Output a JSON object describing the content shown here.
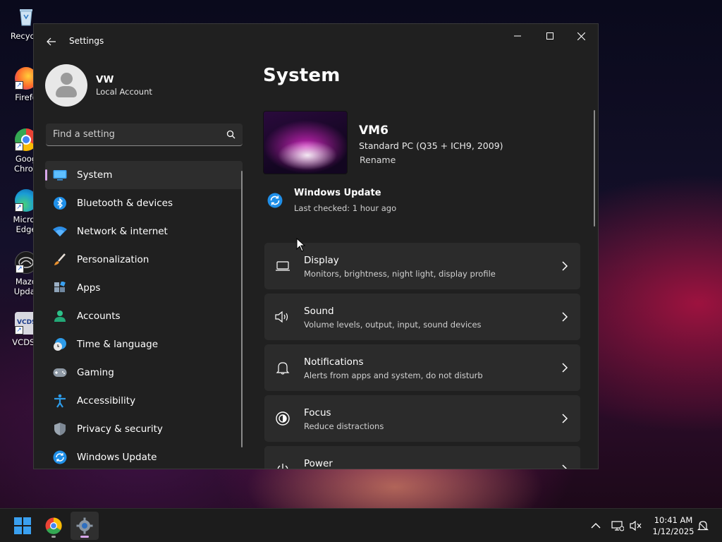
{
  "desktop": {
    "icons": [
      {
        "label": "Recycle",
        "icon": "recycle-bin-icon"
      },
      {
        "label": "Firefo",
        "icon": "firefox-icon"
      },
      {
        "label": "Goog\nChron",
        "icon": "chrome-icon"
      },
      {
        "label": "Micros\nEdge",
        "icon": "edge-icon"
      },
      {
        "label": "Mazd\nUpdat",
        "icon": "mazda-update-icon"
      },
      {
        "label": "VCDS-l",
        "icon": "vcds-icon"
      }
    ]
  },
  "window": {
    "title": "Settings",
    "controls": {
      "minimize": "—",
      "maximize": "☐",
      "close": "✕"
    }
  },
  "profile": {
    "name": "VW",
    "account_type": "Local Account"
  },
  "search": {
    "placeholder": "Find a setting",
    "value": ""
  },
  "sidebar": {
    "items": [
      {
        "label": "System",
        "icon": "system-icon",
        "selected": true
      },
      {
        "label": "Bluetooth & devices",
        "icon": "bluetooth-icon",
        "selected": false
      },
      {
        "label": "Network & internet",
        "icon": "wifi-icon",
        "selected": false
      },
      {
        "label": "Personalization",
        "icon": "brush-icon",
        "selected": false
      },
      {
        "label": "Apps",
        "icon": "apps-icon",
        "selected": false
      },
      {
        "label": "Accounts",
        "icon": "accounts-icon",
        "selected": false
      },
      {
        "label": "Time & language",
        "icon": "time-language-icon",
        "selected": false
      },
      {
        "label": "Gaming",
        "icon": "gaming-icon",
        "selected": false
      },
      {
        "label": "Accessibility",
        "icon": "accessibility-icon",
        "selected": false
      },
      {
        "label": "Privacy & security",
        "icon": "shield-icon",
        "selected": false
      },
      {
        "label": "Windows Update",
        "icon": "windows-update-icon",
        "selected": false
      }
    ]
  },
  "main": {
    "page_title": "System",
    "device": {
      "name": "VM6",
      "model": "Standard PC (Q35 + ICH9, 2009)",
      "rename_label": "Rename"
    },
    "windows_update": {
      "title": "Windows Update",
      "status": "Last checked: 1 hour ago"
    },
    "cards": [
      {
        "title": "Display",
        "subtitle": "Monitors, brightness, night light, display profile",
        "icon": "display-icon"
      },
      {
        "title": "Sound",
        "subtitle": "Volume levels, output, input, sound devices",
        "icon": "speaker-icon"
      },
      {
        "title": "Notifications",
        "subtitle": "Alerts from apps and system, do not disturb",
        "icon": "bell-icon"
      },
      {
        "title": "Focus",
        "subtitle": "Reduce distractions",
        "icon": "focus-icon"
      },
      {
        "title": "Power",
        "subtitle": "",
        "icon": "power-icon"
      }
    ]
  },
  "taskbar": {
    "apps": [
      {
        "name": "Start",
        "icon": "windows-start-icon"
      },
      {
        "name": "Google Chrome",
        "icon": "chrome-icon"
      },
      {
        "name": "Settings",
        "icon": "settings-gear-icon",
        "active": true
      }
    ],
    "tray": {
      "time": "10:41 AM",
      "date": "1/12/2025"
    }
  },
  "colors": {
    "accent": "#d7a6ea",
    "window_bg": "#202020",
    "card_bg": "#2b2b2b",
    "selected_bg": "#2d2d2d"
  }
}
